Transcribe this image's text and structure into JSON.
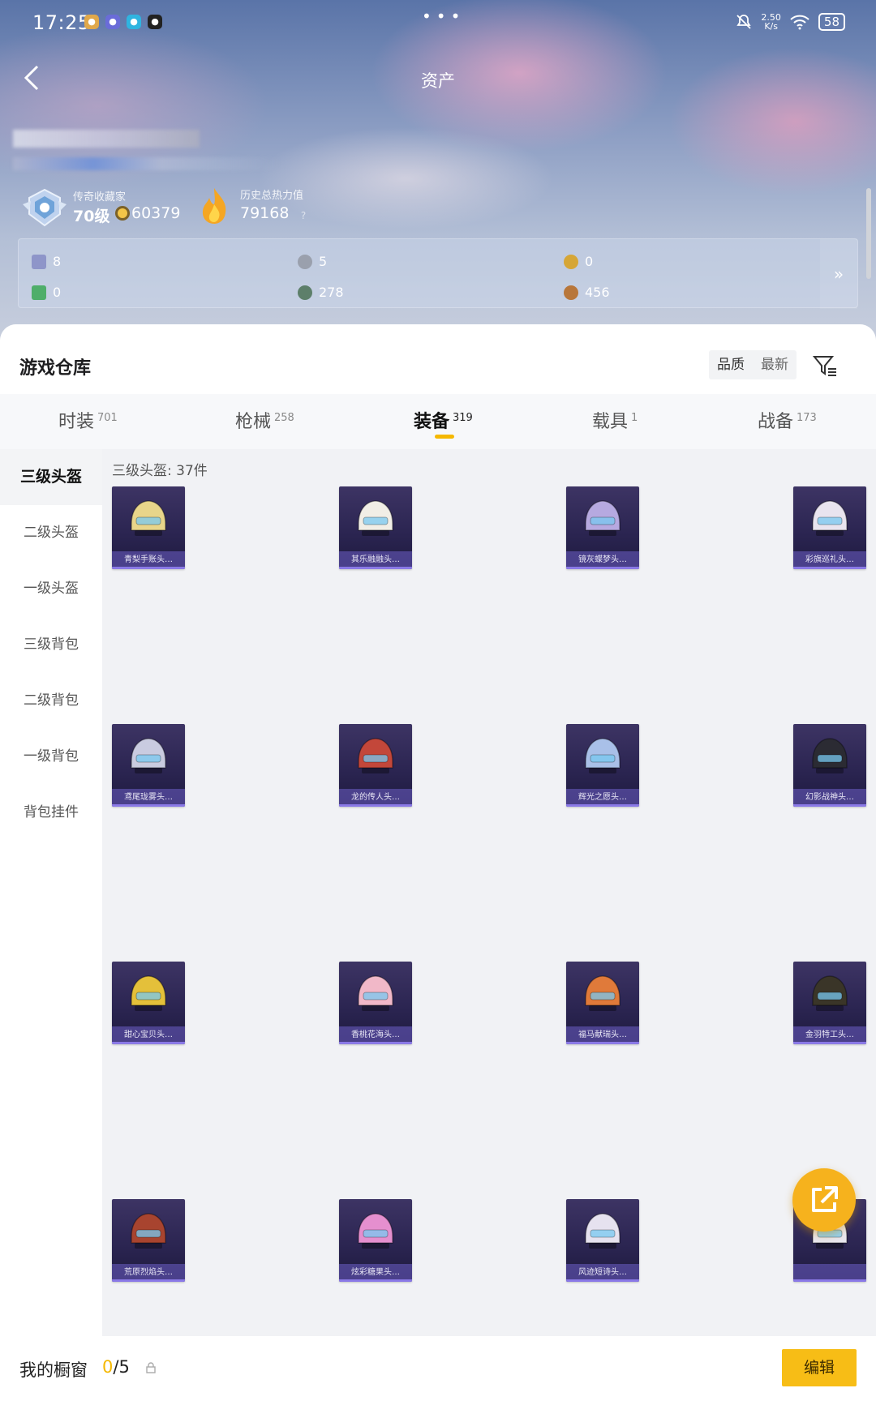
{
  "status_bar": {
    "time": "17:25",
    "net_speed_value": "2.50",
    "net_speed_unit": "K/s",
    "battery": "58"
  },
  "header": {
    "title": "资产",
    "back_icon": "chevron-left-icon"
  },
  "profile": {
    "rank_title": "传奇收藏家",
    "rank_level": "70级",
    "coins": "60379",
    "heat_title": "历史总热力值",
    "heat_value": "79168",
    "help": "?"
  },
  "stats": [
    {
      "value": "8",
      "color": "#8e95c9"
    },
    {
      "value": "5",
      "color": "#9aa0ad"
    },
    {
      "value": "0",
      "color": "#d6a636"
    },
    {
      "value": "0",
      "color": "#4fae6a"
    },
    {
      "value": "278",
      "color": "#5d7f6a"
    },
    {
      "value": "456",
      "color": "#b8763a"
    }
  ],
  "warehouse": {
    "title": "游戏仓库",
    "sort_quality": "品质",
    "sort_latest": "最新"
  },
  "tabs": [
    {
      "label": "时装",
      "count": "701"
    },
    {
      "label": "枪械",
      "count": "258"
    },
    {
      "label": "装备",
      "count": "319"
    },
    {
      "label": "载具",
      "count": "1"
    },
    {
      "label": "战备",
      "count": "173"
    }
  ],
  "sidebar": [
    {
      "label": "三级头盔"
    },
    {
      "label": "二级头盔"
    },
    {
      "label": "一级头盔"
    },
    {
      "label": "三级背包"
    },
    {
      "label": "二级背包"
    },
    {
      "label": "一级背包"
    },
    {
      "label": "背包挂件"
    }
  ],
  "grid": {
    "count_label": "三级头盔: 37件",
    "items": [
      {
        "name": "青梨手账头…",
        "color": "#e8d58a"
      },
      {
        "name": "其乐融融头…",
        "color": "#f1eee6"
      },
      {
        "name": "镜灰蝶梦头…",
        "color": "#b6a9e0"
      },
      {
        "name": "彩旗巡礼头…",
        "color": "#e9e4ef"
      },
      {
        "name": "鸢尾珑雾头…",
        "color": "#c9cbe0"
      },
      {
        "name": "龙的传人头…",
        "color": "#c3473a"
      },
      {
        "name": "辉光之愿头…",
        "color": "#a9c0e8"
      },
      {
        "name": "幻影战神头…",
        "color": "#2b2b33"
      },
      {
        "name": "甜心宝贝头…",
        "color": "#e4c03a"
      },
      {
        "name": "香桃花海头…",
        "color": "#f1b8c8"
      },
      {
        "name": "福马献瑞头…",
        "color": "#e07a3a"
      },
      {
        "name": "金羽特工头…",
        "color": "#3a3528"
      },
      {
        "name": "荒原烈焰头…",
        "color": "#a8442f"
      },
      {
        "name": "炫彩糖果头…",
        "color": "#e58fcf"
      },
      {
        "name": "风迹短诗头…",
        "color": "#e6e2ef"
      },
      {
        "name": "",
        "color": "#e8e6ee"
      }
    ]
  },
  "showcase": {
    "label": "我的橱窗",
    "current": "0",
    "max": "/5",
    "edit": "编辑"
  }
}
